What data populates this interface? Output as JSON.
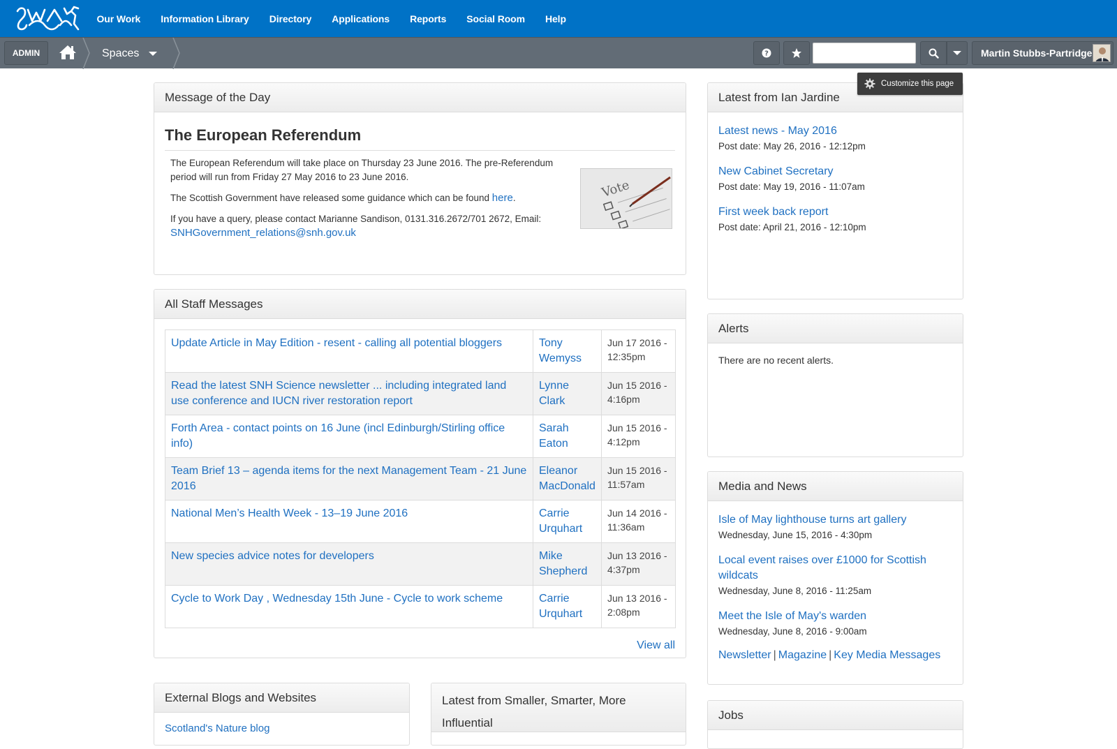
{
  "top_nav": {
    "items": [
      "Our Work",
      "Information Library",
      "Directory",
      "Applications",
      "Reports",
      "Social Room",
      "Help"
    ]
  },
  "sub_bar": {
    "admin_label": "ADMIN",
    "spaces_label": "Spaces",
    "search_value": "",
    "user_name": "Martin Stubbs-Partridge"
  },
  "customize_label": "Customize this page",
  "motd": {
    "panel_title": "Message of the Day",
    "heading": "The European Referendum",
    "para1": "The European Referendum will take place on Thursday 23 June 2016.  The pre-Referendum period will run from Friday 27 May 2016 to 23 June 2016.",
    "para2_text": "The Scottish Government have released some guidance which can be found ",
    "para2_link": "here",
    "para2_end": ".",
    "para3_text": "If you have a query, please contact Marianne Sandison, 0131.316.2672/701 2672, Email:",
    "para3_email": "SNHGovernment_relations@snh.gov.uk",
    "image_text": "Vote"
  },
  "staff_messages": {
    "panel_title": "All Staff Messages",
    "rows": [
      {
        "title": "Update Article in May Edition - resent - calling all potential bloggers",
        "author": "Tony Wemyss",
        "date": "Jun 17 2016 - 12:35pm"
      },
      {
        "title": "Read the latest SNH Science newsletter ... including integrated land use conference and IUCN river restoration report",
        "author": "Lynne Clark",
        "date": "Jun 15 2016 - 4:16pm"
      },
      {
        "title": "Forth Area - contact points on 16 June (incl Edinburgh/Stirling office info)",
        "author": "Sarah Eaton",
        "date": "Jun 15 2016 - 4:12pm"
      },
      {
        "title": "Team Brief 13 – agenda items for the next Management Team - 21 June 2016",
        "author": "Eleanor MacDonald",
        "date": "Jun 15 2016 - 11:57am"
      },
      {
        "title": "National Men’s Health Week - 13–19 June 2016",
        "author": "Carrie Urquhart",
        "date": "Jun 14 2016 - 11:36am"
      },
      {
        "title": "New species advice notes for developers",
        "author": "Mike Shepherd",
        "date": "Jun 13 2016 - 4:37pm"
      },
      {
        "title": "Cycle to Work Day , Wednesday 15th June - Cycle to work scheme",
        "author": "Carrie Urquhart",
        "date": "Jun 13 2016 - 2:08pm"
      }
    ],
    "view_all": "View all"
  },
  "external_blogs": {
    "panel_title": "External Blogs and Websites",
    "first_link": "Scotland's Nature blog"
  },
  "smaller_smarter": {
    "panel_title": "Latest from Smaller, Smarter, More Influential"
  },
  "ian_jardine": {
    "panel_title": "Latest from Ian Jardine",
    "items": [
      {
        "title": "Latest news - May 2016",
        "date": "Post date: May 26, 2016 - 12:12pm"
      },
      {
        "title": "New Cabinet Secretary",
        "date": "Post date: May 19, 2016 - 11:07am"
      },
      {
        "title": "First week back report",
        "date": "Post date: April 21, 2016 - 12:10pm"
      }
    ]
  },
  "alerts": {
    "panel_title": "Alerts",
    "text": "There are no recent alerts."
  },
  "media_news": {
    "panel_title": "Media and News",
    "items": [
      {
        "title": "Isle of May lighthouse turns art gallery",
        "date": "Wednesday, June 15, 2016 - 4:30pm"
      },
      {
        "title": "Local event raises over £1000 for Scottish wildcats",
        "date": "Wednesday, June 8, 2016 - 11:25am"
      },
      {
        "title": "Meet the Isle of May's warden",
        "date": "Wednesday, June 8, 2016 - 9:00am"
      }
    ],
    "links": [
      "Newsletter",
      "Magazine",
      "Key Media Messages"
    ]
  },
  "jobs": {
    "panel_title": "Jobs"
  },
  "colors": {
    "top_bar": "#0072c6",
    "sub_bar": "#626c76",
    "link": "#1f70c1"
  }
}
